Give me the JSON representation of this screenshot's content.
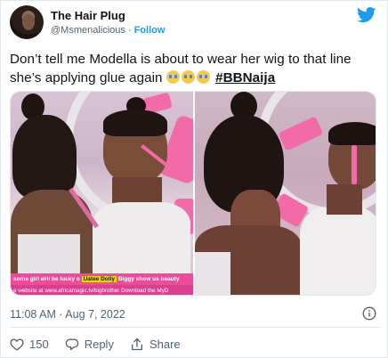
{
  "tweet": {
    "author_name": "The Hair Plug",
    "author_handle": "@Msmenalicious",
    "separator": "·",
    "follow_label": "Follow",
    "text_main": "Don’t tell me Modella is about to wear her wig to that line she’s applying glue again",
    "hashtag": "#BBNaija",
    "emoji_count": 3,
    "timestamp": "11:08 AM · Aug 7, 2022"
  },
  "media": {
    "ticker_line1_a": "some girl will be lucky o",
    "ticker_line1_tag": "Uatee Dolly",
    "ticker_line1_b": "Biggy show us beauty",
    "ticker_line2": "e website at www.africamagic.tv/bigbrother   Download the MyD"
  },
  "actions": {
    "like_count": "150",
    "reply_label": "Reply",
    "share_label": "Share"
  },
  "colors": {
    "accent": "#1d9bf0",
    "muted": "#536471",
    "text": "#0f1419",
    "ticker_pink": "#f04a9b"
  },
  "icons": [
    "twitter-bird-icon",
    "info-icon",
    "heart-icon",
    "reply-icon",
    "share-icon",
    "crying-face-emoji"
  ]
}
